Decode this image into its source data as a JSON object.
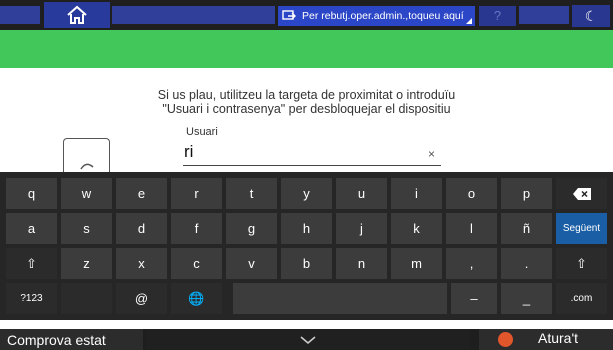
{
  "topbar": {
    "notice": "Per rebutj.oper.admin.,toqueu aquí",
    "help": "?"
  },
  "login": {
    "instruction_line1": "Si us plau, utilitzeu la targeta de proximitat o introduïu",
    "instruction_line2": "\"Usuari i contrasenya\" per desbloquejar el dispositiu",
    "user_label": "Usuari",
    "user_value": "ri",
    "clear": "×"
  },
  "keyboard": {
    "row1": [
      "q",
      "w",
      "e",
      "r",
      "t",
      "y",
      "u",
      "i",
      "o",
      "p",
      "⌫"
    ],
    "row2": [
      "a",
      "s",
      "d",
      "f",
      "g",
      "h",
      "j",
      "k",
      "l",
      "ñ",
      "Següent"
    ],
    "row3": [
      "⇧",
      "z",
      "x",
      "c",
      "v",
      "b",
      "n",
      "m",
      ",",
      ".",
      "⇧"
    ],
    "row4": [
      "?123",
      "",
      "@",
      "🌐",
      "",
      "–",
      "_",
      ".com"
    ]
  },
  "bottombar": {
    "check_status": "Comprova estat",
    "collapse": "⌄",
    "stop": "Atura't"
  },
  "colors": {
    "green_banner": "#41c75a",
    "notice_blue": "#2b46c6",
    "next_key": "#1a5ea5",
    "stop_orange": "#e2562c"
  }
}
